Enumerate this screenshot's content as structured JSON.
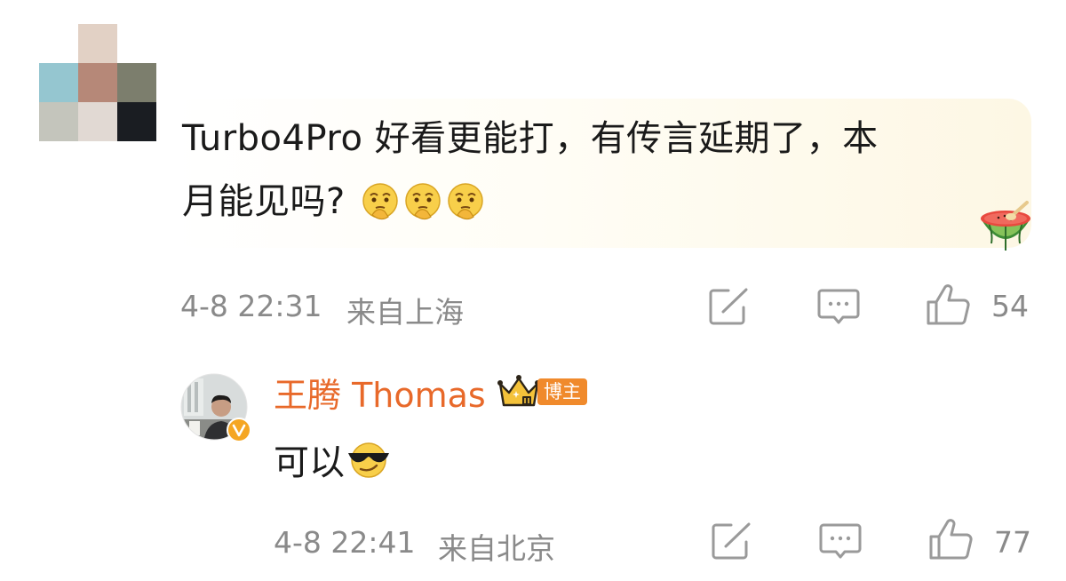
{
  "comment": {
    "line1": "Turbo4Pro 好看更能打，有传言延期了，本",
    "line2": "月能见吗?",
    "emoji_names": [
      "thinking-face-emoji",
      "thinking-face-emoji",
      "thinking-face-emoji"
    ],
    "time": "4-8 22:31",
    "location": "来自上海",
    "likes": "54",
    "decoration": "watermelon-icon"
  },
  "reply": {
    "author": "王腾 Thomas",
    "badge": "博主",
    "text": "可以",
    "emoji_name": "sunglasses-face-emoji",
    "time": "4-8 22:41",
    "location": "来自北京",
    "likes": "77"
  },
  "colors": {
    "accent": "#e8692a",
    "badge": "#f08a2c",
    "meta": "#8a8a8a",
    "icon": "#9a9a9a"
  }
}
